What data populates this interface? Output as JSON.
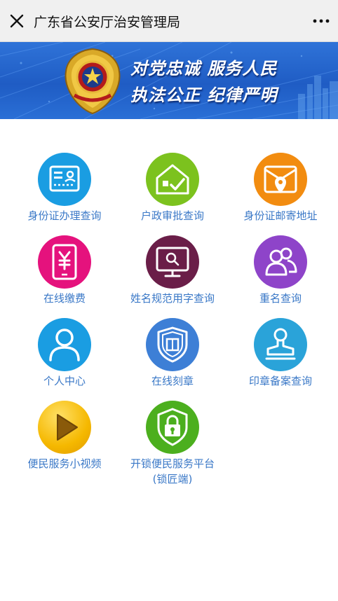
{
  "topbar": {
    "title": "广东省公安厅治安管理局",
    "close_icon": "close-icon",
    "more_icon": "more-dots-icon"
  },
  "banner": {
    "slogan_line1": "对党忠诚 服务人民",
    "slogan_line2": "执法公正 纪律严明",
    "emblem_icon": "police-emblem-icon"
  },
  "services": [
    {
      "label": "身份证办理查询",
      "icon": "id-card-icon",
      "color": "#1a9de2"
    },
    {
      "label": "户政审批查询",
      "icon": "house-check-icon",
      "color": "#7cc21e"
    },
    {
      "label": "身份证邮寄地址",
      "icon": "envelope-location-icon",
      "color": "#f28c10"
    },
    {
      "label": "在线缴费",
      "icon": "yuan-tablet-icon",
      "color": "#e5127d"
    },
    {
      "label": "姓名规范用字查询",
      "icon": "monitor-search-icon",
      "color": "#6a1e48"
    },
    {
      "label": "重名查询",
      "icon": "users-icon",
      "color": "#8e44c9"
    },
    {
      "label": "个人中心",
      "icon": "user-icon",
      "color": "#1a9de2"
    },
    {
      "label": "在线刻章",
      "icon": "shield-seal-icon",
      "color": "#3d7fd6"
    },
    {
      "label": "印章备案查询",
      "icon": "stamp-icon",
      "color": "#2aa3d9"
    },
    {
      "label": "便民服务小视频",
      "icon": "play-icon",
      "color": "#f5b800"
    },
    {
      "label": "开锁便民服务平台",
      "label2": "(锁匠端)",
      "icon": "lock-shield-icon",
      "color": "#4caf1e"
    }
  ]
}
